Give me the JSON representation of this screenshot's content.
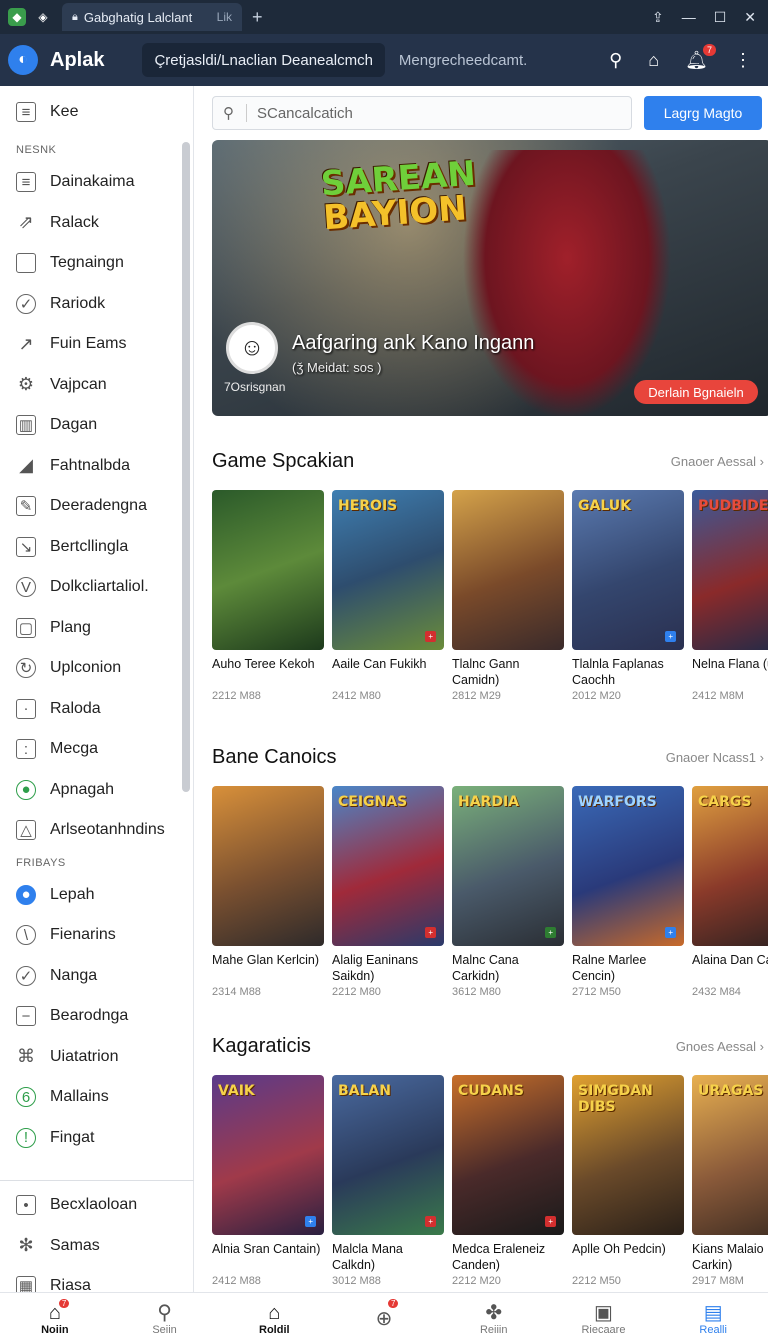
{
  "browser": {
    "tab_title": "Gabghatig Lalclant",
    "tab_close": "Lik",
    "new_tab": "+"
  },
  "header": {
    "app_name": "Aplak",
    "url": "Çretjasldi/Lnaclian Deanealcmch",
    "url_suffix": "Mengrecheedcamt.",
    "notif_count": "7"
  },
  "sidebar": {
    "top_item": "Kee",
    "section1": "NESNK",
    "items1": [
      "Dainakaima",
      "Ralack",
      "Tegnaingn",
      "Rariodk",
      "Fuin Eams",
      "Vajpcan",
      "Dagan",
      "Fahtnalbda",
      "Deeradengna",
      "Bertcllingla",
      "Dolkcliartaliol.",
      "Plang",
      "Uplconion",
      "Raloda",
      "Mecga",
      "Apnagah",
      "Arlseotanhndins"
    ],
    "section2": "FRIBAYS",
    "items2": [
      "Lepah",
      "Fienarins",
      "Nanga",
      "Bearodnga",
      "Uiatatrion",
      "Mallains",
      "Fingat"
    ],
    "items3": [
      "Becxlaoloan",
      "Samas",
      "Riasa"
    ]
  },
  "search": {
    "placeholder": "SCancalcatich",
    "button": "Lagrg Magto"
  },
  "hero": {
    "logo_line1": "SAREAN",
    "logo_line2": "BAYION",
    "title": "Aafgaring ank Kano Ingann",
    "subtitle": "(ǯ Meidat: sos )",
    "meta": "7Osrisgnan",
    "button": "Derlain Bgnaieln"
  },
  "sections": [
    {
      "title": "Game Spcakian",
      "more": "Gnaoer Aessal",
      "cards": [
        {
          "art": "",
          "name": "Auho Teree Kekoh",
          "size": "2212 M88"
        },
        {
          "art": "HEROIS",
          "name": "Aaile Can Fukikh",
          "size": "2412 M80"
        },
        {
          "art": "",
          "name": "Tlalnc Gann Camidn)",
          "size": "2812 M29"
        },
        {
          "art": "GALUK",
          "name": "Tlalnla Faplanas Caochh",
          "size": "2012 M20"
        },
        {
          "art": "PUDBIDE",
          "name": "Nelna Flana (ualkdi)",
          "size": "2412 M8M"
        }
      ]
    },
    {
      "title": "Bane Canoics",
      "more": "Gnaoer Ncass1",
      "cards": [
        {
          "art": "",
          "name": "Mahe Glan Kerlcin)",
          "size": "2314 M88"
        },
        {
          "art": "CEIGNAS",
          "name": "Alalig Eaninans Saikdn)",
          "size": "2212 M80"
        },
        {
          "art": "HARDIA",
          "name": "Malnc Cana Carkidn)",
          "size": "3612 M80"
        },
        {
          "art": "WARFORS",
          "name": "Ralne Marlee Cencin)",
          "size": "2712 M50"
        },
        {
          "art": "CARGS",
          "name": "Alaina Dan Caolcor)",
          "size": "2432 M84"
        }
      ]
    },
    {
      "title": "Kagaraticis",
      "more": "Gnoes Aessal",
      "cards": [
        {
          "art": "VAIK",
          "name": "Alnia Sran Cantain)",
          "size": "2412 M88"
        },
        {
          "art": "BALAN",
          "name": "Malcla Mana Calkdn)",
          "size": "3012 M88"
        },
        {
          "art": "CUDANS",
          "name": "Medca Eraleneiz Canden)",
          "size": "2212 M20"
        },
        {
          "art": "SIMGDAN DIBS",
          "name": "Aplle Oh Pedcin)",
          "size": "2212 M50"
        },
        {
          "art": "URAGAS",
          "name": "Kians Malaio Carkin)",
          "size": "2917 M8M"
        }
      ]
    }
  ],
  "bottom_nav": [
    {
      "label": "Noiin",
      "badge": "7"
    },
    {
      "label": "Seiin",
      "badge": ""
    },
    {
      "label": "Roldil",
      "badge": ""
    },
    {
      "label": "",
      "badge": "7"
    },
    {
      "label": "Reiiin",
      "badge": ""
    },
    {
      "label": "Riecaare",
      "badge": ""
    },
    {
      "label": "Realli",
      "badge": ""
    }
  ]
}
